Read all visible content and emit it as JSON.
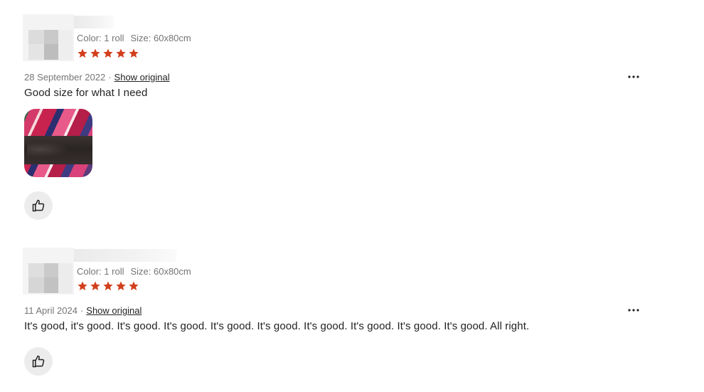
{
  "colors": {
    "star": "#d23f1d",
    "meta_text": "#757575",
    "body_text": "#222222",
    "like_bg": "#ececec"
  },
  "reviews": [
    {
      "sku_color": "Color: 1 roll",
      "sku_size": "Size: 60x80cm",
      "rating": 5,
      "date": "28 September 2022",
      "separator": "·",
      "show_original": "Show original",
      "text": "Good size for what I need",
      "has_photo": true,
      "more_icon": "more-horizontal-icon",
      "like_icon": "thumbs-up-icon"
    },
    {
      "sku_color": "Color: 1 roll",
      "sku_size": "Size: 60x80cm",
      "rating": 5,
      "date": "11 April 2024",
      "separator": "·",
      "show_original": "Show original",
      "text": "It's good, it's good. It's good. It's good. It's good. It's good. It's good. It's good. It's good. It's good. All right.",
      "has_photo": false,
      "more_icon": "more-horizontal-icon",
      "like_icon": "thumbs-up-icon"
    }
  ]
}
